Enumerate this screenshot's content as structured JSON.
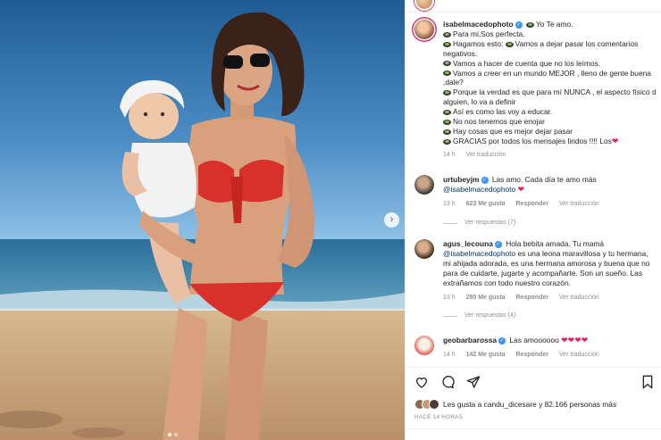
{
  "caption": {
    "username": "isabelmacedophoto",
    "lines": [
      "Yo Te amo.",
      "Para mi,Sos perfecta.",
      "Hagamos esto:",
      "Vamos a dejar pasar los comentarios",
      "negativos.",
      "Vamos a hacer de cuenta que no los leímos.",
      "Vamos a creer en un mundo MEJOR , lleno de gente buena",
      ",dale?",
      "Porque la verdad es que para mí NUNCA , el aspecto físico de",
      "alguien, lo va a definir",
      "Así es como las voy a educar.",
      "No nos tenemos que enojar",
      "Hay cosas que es mejor dejar pasar",
      "GRACIAS por todos los mensajes lindos !!!! Los"
    ],
    "time": "14 h",
    "translate": "Ver traducción"
  },
  "comments": [
    {
      "username": "urtubeyjm",
      "text": "Las amo. Cada día te amo más",
      "mention": "@isabelmacedophoto",
      "time": "13 h",
      "likes": "623 Me gusta",
      "reply": "Responder",
      "translate": "Ver traducción",
      "replies": "Ver respuestas (7)"
    },
    {
      "username": "agus_lecouna",
      "text_lines": [
        "Hola bebita amada. Tu mamá",
        "es una leona maravillosa y tu hermana,",
        "mi ahijada adorada, es una hermana amorosa y buena que no",
        "para de cuidarte, jugarte y acompañarte. Son un sueño. Las",
        "extrañamos con todo nuestro corazón."
      ],
      "mention": "@isabelmacedophoto",
      "time": "13 h",
      "likes": "280 Me gusta",
      "reply": "Responder",
      "translate": "Ver traducción",
      "replies": "Ver respuestas (4)"
    },
    {
      "username": "geobarbarossa",
      "text": "Las amoooooo",
      "time": "14 h",
      "likes": "142 Me gusta",
      "reply": "Responder",
      "translate": "Ver traducción"
    }
  ],
  "post": {
    "likes_text": "Les gusta a candu_dicesare y 82.166 personas más",
    "time_ago": "HACE 14 HORAS"
  },
  "icons": [
    "heart-icon",
    "comment-icon",
    "share-icon",
    "save-icon",
    "next-arrow-icon",
    "verified-badge-icon"
  ],
  "colors": {
    "heart": "#e0245e",
    "verified": "#3897f0",
    "link": "#00376b",
    "muted": "#8e8e8e"
  }
}
